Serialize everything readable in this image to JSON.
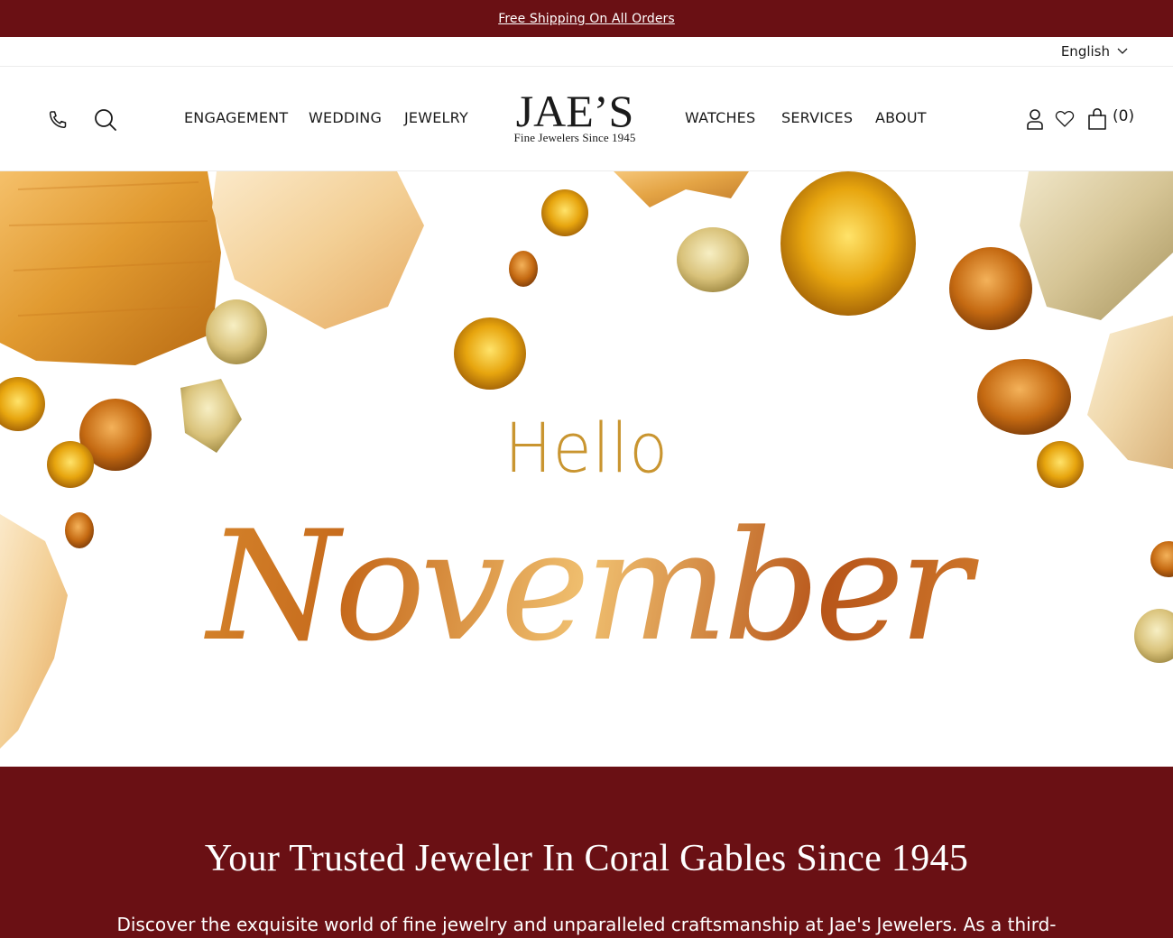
{
  "announcement": {
    "text": "Free Shipping On All Orders"
  },
  "utility": {
    "language": "English"
  },
  "nav": {
    "left": [
      "ENGAGEMENT",
      "WEDDING",
      "JEWELRY"
    ],
    "right": [
      "WATCHES",
      "SERVICES",
      "ABOUT"
    ]
  },
  "logo": {
    "name": "JAE’S",
    "tagline": "Fine Jewelers Since 1945"
  },
  "icons": {
    "phone": "phone-icon",
    "search": "search-icon",
    "account": "user-icon",
    "wishlist": "heart-icon",
    "cart": "shopping-bag-icon",
    "language_caret": "chevron-down-icon"
  },
  "cart": {
    "count": "(0)"
  },
  "hero": {
    "line1": "Hello",
    "line2": "November"
  },
  "band": {
    "title": "Your Trusted Jeweler In Coral Gables Since 1945",
    "text": "Discover the exquisite world of fine jewelry and unparalleled craftsmanship at Jae's Jewelers. As a third-"
  },
  "colors": {
    "brand": "#6a1014",
    "gold": "#c99530",
    "amber": "#d5862a"
  }
}
